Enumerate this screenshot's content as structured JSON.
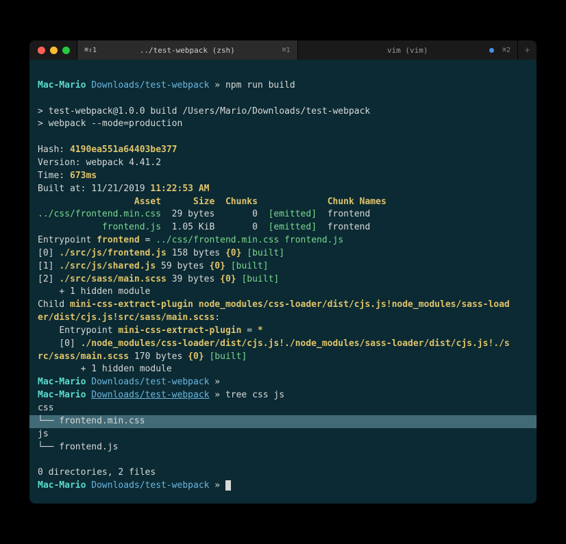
{
  "window": {
    "traffic": [
      "red",
      "yellow",
      "green"
    ]
  },
  "tabs": {
    "tab1": {
      "prefix": "⌘⇧1",
      "title": "../test-webpack (zsh)",
      "shortcut": "⌘1"
    },
    "tab2": {
      "title": "vim (vim)",
      "shortcut": "⌘2"
    },
    "addGlyph": "+"
  },
  "prompt1": {
    "host": "Mac-Mario",
    "path": "Downloads/test-webpack",
    "sep": "»",
    "cmd": "npm run build"
  },
  "build": {
    "l1": "> test-webpack@1.0.0 build /Users/Mario/Downloads/test-webpack",
    "l2": "> webpack --mode=production"
  },
  "stats": {
    "hashLabel": "Hash:",
    "hash": "4190ea551a64403be377",
    "versionLabel": "Version:",
    "version": "webpack 4.41.2",
    "timeLabel": "Time:",
    "time": "673ms",
    "builtAtLabel": "Built at:",
    "builtAt": "11/21/2019 11:22:53 AM"
  },
  "table": {
    "headers": {
      "asset": "Asset",
      "size": "Size",
      "chunks": "Chunks",
      "chunkNames": "Chunk Names"
    },
    "row1": {
      "asset": "../css/frontend.min.css",
      "size": "29 bytes",
      "chunk": "0",
      "emitted": "[emitted]",
      "name": "frontend"
    },
    "row2": {
      "asset": "frontend.js",
      "size": "1.05 KiB",
      "chunk": "0",
      "emitted": "[emitted]",
      "name": "frontend"
    }
  },
  "entry": {
    "label": "Entrypoint",
    "name": "frontend",
    "eq": "=",
    "files": "../css/frontend.min.css frontend.js"
  },
  "modules": {
    "m0": {
      "idx": "[0]",
      "path": "./src/js/frontend.js",
      "size": "158 bytes",
      "chunk": "{0}",
      "tag": "[built]"
    },
    "m1": {
      "idx": "[1]",
      "path": "./src/js/shared.js",
      "size": "59 bytes",
      "chunk": "{0}",
      "tag": "[built]"
    },
    "m2": {
      "idx": "[2]",
      "path": "./src/sass/main.scss",
      "size": "39 bytes",
      "chunk": "{0}",
      "tag": "[built]"
    },
    "hidden": "+ 1 hidden module"
  },
  "child": {
    "label": "Child",
    "name": "mini-css-extract-plugin node_modules/css-loader/dist/cjs.js!node_modules/sass-load",
    "nameCont": "er/dist/cjs.js!src/sass/main.scss",
    "colon": ":",
    "entry": {
      "label": "Entrypoint",
      "name": "mini-css-extract-plugin",
      "eq": "=",
      "star": "*"
    },
    "m0a": "./node_modules/css-loader/dist/cjs.js!./node_modules/sass-loader/dist/cjs.js!./s",
    "m0b": "rc/sass/main.scss",
    "m0idx": "[0]",
    "m0size": "170 bytes",
    "m0chunk": "{0}",
    "m0tag": "[built]",
    "hidden": "+ 1 hidden module"
  },
  "prompt2": {
    "host": "Mac-Mario",
    "path": "Downloads/test-webpack",
    "sep": "»"
  },
  "prompt3": {
    "host": "Mac-Mario",
    "path": "Downloads/test-webpack",
    "sep": "»",
    "cmd": "tree css js"
  },
  "tree": {
    "css": "css",
    "cssFile": "└── frontend.min.css",
    "js": "js",
    "jsFile": "└── frontend.js",
    "summary": "0 directories, 2 files"
  },
  "prompt4": {
    "host": "Mac-Mario",
    "path": "Downloads/test-webpack",
    "sep": "»"
  }
}
